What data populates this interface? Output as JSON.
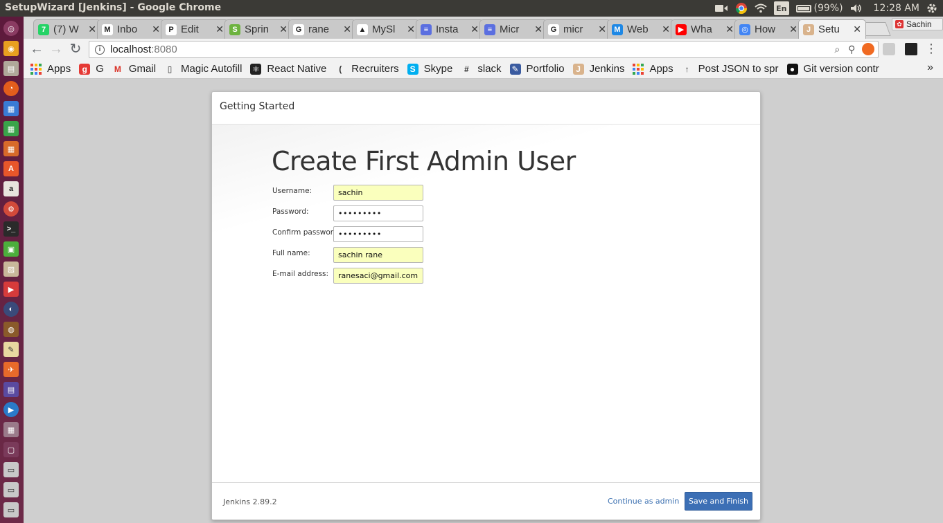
{
  "topbar": {
    "window_title": "SetupWizard [Jenkins] - Google Chrome",
    "battery": "(99%)",
    "time": "12:28 AM",
    "lang": "En"
  },
  "tabs": [
    {
      "label": "(7) W",
      "color": "#25d366",
      "glyph": "7"
    },
    {
      "label": "Inbo",
      "color": "#ffffff",
      "glyph": "M"
    },
    {
      "label": "Edit",
      "color": "#ffffff",
      "glyph": "P"
    },
    {
      "label": "Sprin",
      "color": "#6db33f",
      "glyph": "S"
    },
    {
      "label": "rane",
      "color": "#ffffff",
      "glyph": "G"
    },
    {
      "label": "MySl",
      "color": "#ffffff",
      "glyph": "▲"
    },
    {
      "label": "Insta",
      "color": "#5b6fe0",
      "glyph": "≡"
    },
    {
      "label": "Micr",
      "color": "#5b6fe0",
      "glyph": "≡"
    },
    {
      "label": "micr",
      "color": "#ffffff",
      "glyph": "G"
    },
    {
      "label": "Web",
      "color": "#1e88e5",
      "glyph": "M"
    },
    {
      "label": "Wha",
      "color": "#ff0000",
      "glyph": "▶"
    },
    {
      "label": "How",
      "color": "#4285f4",
      "glyph": "◎"
    },
    {
      "label": "Setu",
      "color": "#d9b38c",
      "glyph": "J"
    }
  ],
  "profile": {
    "name": "Sachin"
  },
  "omnibox": {
    "host": "localhost",
    "port": ":8080"
  },
  "bookmarks": [
    {
      "label": "Apps",
      "icon": "apps-icon"
    },
    {
      "label": "G",
      "icon": "g-icon"
    },
    {
      "label": "Gmail",
      "icon": "gmail-icon"
    },
    {
      "label": "Magic Autofill",
      "icon": "page-icon"
    },
    {
      "label": "React Native",
      "icon": "react-icon"
    },
    {
      "label": "Recruiters",
      "icon": "recruiters-icon"
    },
    {
      "label": "Skype",
      "icon": "skype-icon"
    },
    {
      "label": "slack",
      "icon": "slack-icon"
    },
    {
      "label": "Portfolio",
      "icon": "portfolio-icon"
    },
    {
      "label": "Jenkins",
      "icon": "jenkins-icon"
    },
    {
      "label": "Apps",
      "icon": "apps-icon"
    },
    {
      "label": "Post JSON to spr",
      "icon": "arrow-icon"
    },
    {
      "label": "Git version contr",
      "icon": "github-icon"
    }
  ],
  "dialog": {
    "header": "Getting Started",
    "title": "Create First Admin User",
    "fields": {
      "username": {
        "label": "Username:",
        "value": "sachin"
      },
      "password": {
        "label": "Password:",
        "value": "•••••••••"
      },
      "confirm": {
        "label": "Confirm password:",
        "value": "•••••••••"
      },
      "fullname": {
        "label": "Full name:",
        "value": "sachin rane"
      },
      "email": {
        "label": "E-mail address:",
        "value": "ranesaci@gmail.com"
      }
    },
    "footer": {
      "version": "Jenkins 2.89.2",
      "continue_label": "Continue as admin",
      "save_label": "Save and Finish"
    }
  }
}
